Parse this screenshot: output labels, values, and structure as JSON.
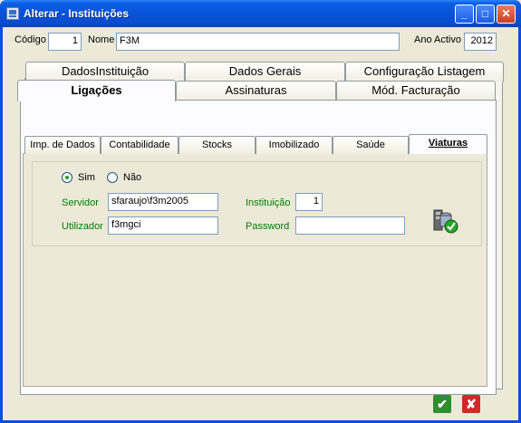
{
  "window": {
    "title": "Alterar - Instituições"
  },
  "header": {
    "codigo_label": "Código",
    "codigo_value": "1",
    "nome_label": "Nome",
    "nome_value": "F3M",
    "ano_label": "Ano Activo",
    "ano_value": "2012"
  },
  "tabs_row1": [
    "DadosInstituição",
    "Dados Gerais",
    "Configuração Listagem"
  ],
  "tabs_row2": [
    "Ligações",
    "Assinaturas",
    "Mód. Facturação"
  ],
  "subtabs": [
    "Imp. de Dados",
    "Contabilidade",
    "Stocks",
    "Imobilizado",
    "Saúde",
    "Viaturas"
  ],
  "panel": {
    "radio_sim": "Sim",
    "radio_nao": "Não",
    "selected": "Sim",
    "servidor_label": "Servidor",
    "servidor_value": "sfaraujo\\f3m2005",
    "instituicao_label": "Instituição",
    "instituicao_value": "1",
    "utilizador_label": "Utilizador",
    "utilizador_value": "f3mgci",
    "password_label": "Password",
    "password_value": ""
  },
  "icons": {
    "test_connection": "database-check-icon",
    "confirm": "check-icon",
    "cancel": "x-icon"
  },
  "colors": {
    "title_bar": "#0a5ee6",
    "field_label": "#008000",
    "confirm": "#2f8f2f",
    "cancel": "#d22828"
  }
}
